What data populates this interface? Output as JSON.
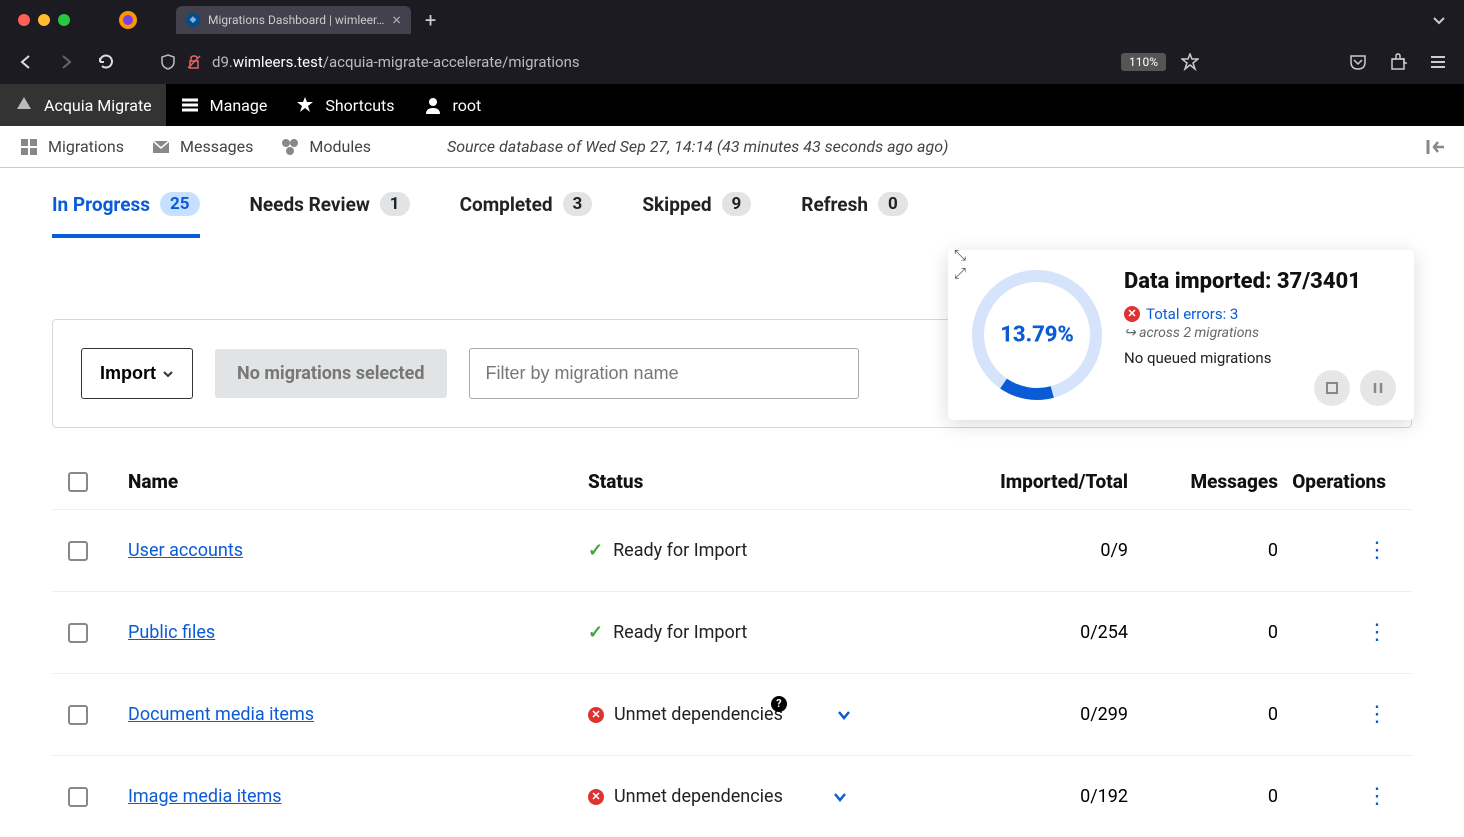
{
  "browser": {
    "tab_title": "Migrations Dashboard | wimleer…",
    "url_prefix": "d9.",
    "url_domain": "wimleers.test",
    "url_path": "/acquia-migrate-accelerate/migrations",
    "zoom": "110%"
  },
  "admin_bar": {
    "brand": "Acquia Migrate",
    "manage": "Manage",
    "shortcuts": "Shortcuts",
    "user": "root"
  },
  "secondary": {
    "migrations": "Migrations",
    "messages": "Messages",
    "modules": "Modules",
    "source_info": "Source database of Wed Sep 27, 14:14 (43 minutes 43 seconds ago ago)"
  },
  "tabs": {
    "in_progress": {
      "label": "In Progress",
      "count": "25"
    },
    "needs_review": {
      "label": "Needs Review",
      "count": "1"
    },
    "completed": {
      "label": "Completed",
      "count": "3"
    },
    "skipped": {
      "label": "Skipped",
      "count": "9"
    },
    "refresh": {
      "label": "Refresh",
      "count": "0"
    }
  },
  "actions": {
    "import": "Import",
    "no_selection": "No migrations selected",
    "filter_placeholder": "Filter by migration name"
  },
  "progress": {
    "percent": "13.79%",
    "title": "Data imported: 37/3401",
    "errors": "Total errors: 3",
    "across": "across 2 migrations",
    "queued": "No queued migrations"
  },
  "table": {
    "headers": {
      "name": "Name",
      "status": "Status",
      "imported": "Imported/Total",
      "messages": "Messages",
      "operations": "Operations"
    },
    "rows": [
      {
        "name": "User accounts",
        "status_type": "ready",
        "status": "Ready for Import",
        "imported": "0/9",
        "messages": "0"
      },
      {
        "name": "Public files",
        "status_type": "ready",
        "status": "Ready for Import",
        "imported": "0/254",
        "messages": "0"
      },
      {
        "name": "Document media items",
        "status_type": "unmet",
        "status": "Unmet dependencies",
        "imported": "0/299",
        "messages": "0",
        "help": true
      },
      {
        "name": "Image media items",
        "status_type": "unmet",
        "status": "Unmet dependencies",
        "imported": "0/192",
        "messages": "0"
      }
    ]
  }
}
